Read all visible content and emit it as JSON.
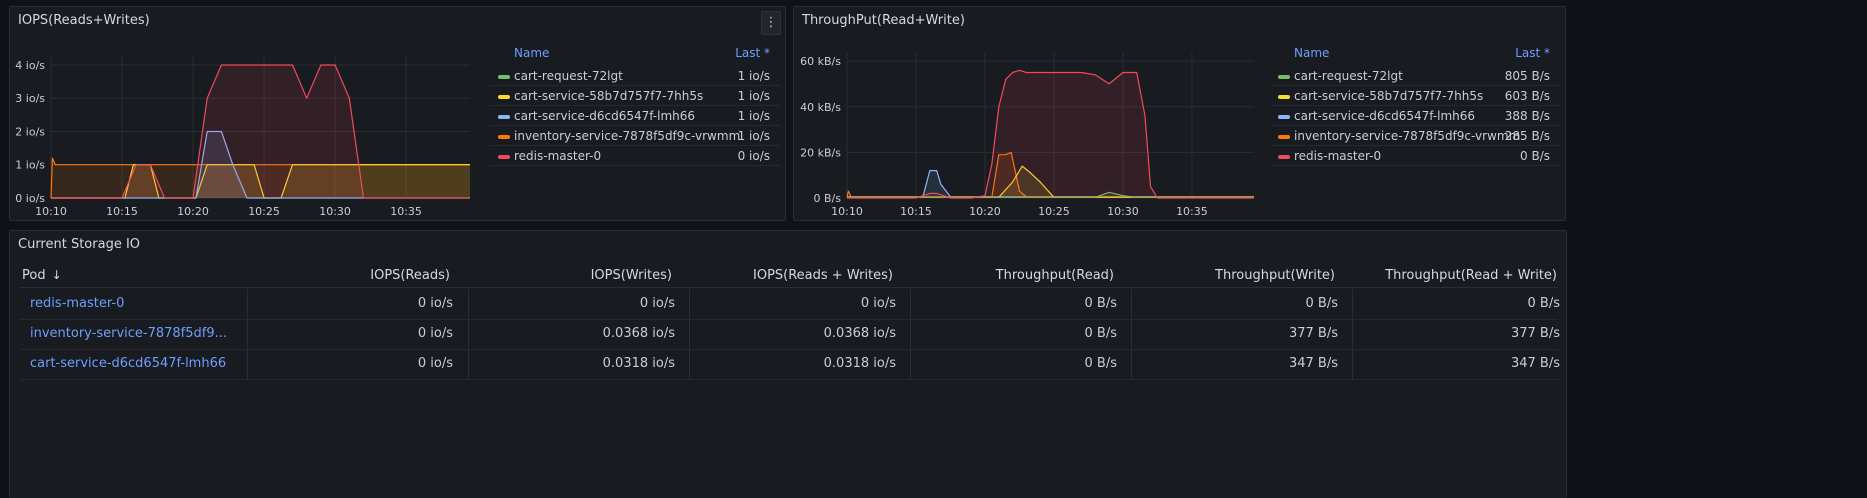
{
  "iops_panel": {
    "title": "IOPS(Reads+Writes)",
    "menu_icon": "more-vertical-icon",
    "legend": {
      "name_header": "Name",
      "last_header": "Last *",
      "items": [
        {
          "name": "cart-request-72lgt",
          "last": "1 io/s",
          "color": "#73bf69"
        },
        {
          "name": "cart-service-58b7d757f7-7hh5s",
          "last": "1 io/s",
          "color": "#fade2a"
        },
        {
          "name": "cart-service-d6cd6547f-lmh66",
          "last": "1 io/s",
          "color": "#8ab8ff"
        },
        {
          "name": "inventory-service-7878f5df9c-vrwmm",
          "last": "1 io/s",
          "color": "#ff780a"
        },
        {
          "name": "redis-master-0",
          "last": "0 io/s",
          "color": "#f2495c"
        }
      ]
    },
    "chart_data": {
      "type": "area",
      "ylim": [
        0,
        4.3
      ],
      "y_ticks": [
        "0 io/s",
        "1 io/s",
        "2 io/s",
        "3 io/s",
        "4 io/s"
      ],
      "y_tick_values": [
        0,
        1,
        2,
        3,
        4
      ],
      "x_ticks": [
        "10:10",
        "10:15",
        "10:20",
        "10:25",
        "10:30",
        "10:35"
      ],
      "x_tick_values": [
        0,
        5,
        10,
        15,
        20,
        25
      ],
      "xlim": [
        0,
        29.5
      ],
      "series": [
        {
          "name": "inventory-service-7878f5df9c-vrwmm",
          "color": "#ff780a",
          "x": [
            0,
            0.1,
            0.3,
            29.5
          ],
          "y": [
            0,
            1.2,
            1,
            1
          ]
        },
        {
          "name": "cart-service-58b7d757f7-7hh5s",
          "color": "#fade2a",
          "x": [
            0,
            5.2,
            5.8,
            6.4,
            7,
            7.6,
            10.2,
            11,
            12,
            13,
            14.3,
            15,
            16.2,
            17,
            29.5
          ],
          "y": [
            0,
            0,
            1,
            1,
            1,
            0,
            0,
            1,
            1,
            1,
            1,
            0,
            0,
            1,
            1
          ]
        },
        {
          "name": "cart-service-d6cd6547f-lmh66",
          "color": "#8ab8ff",
          "x": [
            0,
            10.2,
            11,
            12,
            12.8,
            13.8,
            29.5
          ],
          "y": [
            0,
            0,
            2,
            2,
            1,
            0,
            0
          ]
        },
        {
          "name": "redis-master-0",
          "color": "#f2495c",
          "x": [
            0,
            5,
            6,
            7,
            8,
            10,
            11,
            12,
            13,
            14,
            15,
            17,
            18,
            19,
            20,
            21,
            22,
            29.5
          ],
          "y": [
            0,
            0,
            1,
            1,
            0,
            0,
            3,
            4,
            4,
            4,
            4,
            4,
            3,
            4,
            4,
            3,
            0,
            0
          ]
        }
      ]
    }
  },
  "throughput_panel": {
    "title": "ThroughPut(Read+Write)",
    "legend": {
      "name_header": "Name",
      "last_header": "Last *",
      "items": [
        {
          "name": "cart-request-72lgt",
          "last": "805 B/s",
          "color": "#73bf69"
        },
        {
          "name": "cart-service-58b7d757f7-7hh5s",
          "last": "603 B/s",
          "color": "#fade2a"
        },
        {
          "name": "cart-service-d6cd6547f-lmh66",
          "last": "388 B/s",
          "color": "#8ab8ff"
        },
        {
          "name": "inventory-service-7878f5df9c-vrwmm",
          "last": "285 B/s",
          "color": "#ff780a"
        },
        {
          "name": "redis-master-0",
          "last": "0 B/s",
          "color": "#f2495c"
        }
      ]
    },
    "chart_data": {
      "type": "area",
      "ylim": [
        0,
        64
      ],
      "y_ticks": [
        "0 B/s",
        "20 kB/s",
        "40 kB/s",
        "60 kB/s"
      ],
      "y_tick_values": [
        0,
        20,
        40,
        60
      ],
      "x_ticks": [
        "10:10",
        "10:15",
        "10:20",
        "10:25",
        "10:30",
        "10:35"
      ],
      "x_tick_values": [
        0,
        5,
        10,
        15,
        20,
        25
      ],
      "xlim": [
        0,
        29.5
      ],
      "series": [
        {
          "name": "cart-service-d6cd6547f-lmh66",
          "color": "#8ab8ff",
          "x": [
            0,
            5.5,
            6,
            6.5,
            6.8,
            7.5,
            8,
            29.5
          ],
          "y": [
            0.5,
            0.5,
            12,
            12,
            6,
            0.5,
            0.5,
            0.5
          ]
        },
        {
          "name": "inventory-service-7878f5df9c-vrwmm",
          "color": "#ff780a",
          "x": [
            0,
            0.1,
            0.3,
            10.5,
            11,
            11.5,
            11.9,
            12.5,
            13,
            29.5
          ],
          "y": [
            0.5,
            3,
            0.5,
            0.5,
            19,
            19,
            20,
            3,
            0.5,
            0.5
          ]
        },
        {
          "name": "cart-service-58b7d757f7-7hh5s",
          "color": "#fade2a",
          "x": [
            0,
            11,
            12,
            12.7,
            13.3,
            14,
            14.6,
            15,
            29.5
          ],
          "y": [
            0.3,
            0.3,
            7,
            14,
            11,
            7,
            3,
            0.3,
            0.3
          ]
        },
        {
          "name": "cart-request-72lgt",
          "color": "#73bf69",
          "x": [
            0,
            18,
            19,
            20,
            21,
            29.5
          ],
          "y": [
            0.3,
            0.3,
            2.5,
            1,
            0.3,
            0.3
          ]
        },
        {
          "name": "redis-master-0",
          "color": "#f2495c",
          "x": [
            0,
            5,
            6,
            6.5,
            7,
            7.5,
            9,
            10,
            10.5,
            11,
            11.5,
            12,
            12.5,
            13,
            15,
            17,
            18,
            19,
            20,
            21,
            21.6,
            22,
            22.5,
            29.5
          ],
          "y": [
            0,
            0,
            2,
            2,
            1,
            0,
            0,
            1,
            15,
            40,
            52,
            55,
            56,
            55,
            55,
            55,
            54,
            50,
            55,
            55,
            36,
            5,
            0,
            0
          ]
        }
      ]
    }
  },
  "storage_panel": {
    "title": "Current Storage IO",
    "columns": [
      {
        "label": "Pod",
        "sort_icon": "arrow-down-icon"
      },
      {
        "label": "IOPS(Reads)"
      },
      {
        "label": "IOPS(Writes)"
      },
      {
        "label": "IOPS(Reads + Writes)"
      },
      {
        "label": "Throughput(Read)"
      },
      {
        "label": "Throughput(Write)"
      },
      {
        "label": "Throughput(Read + Write)"
      }
    ],
    "sort_arrow": "↓",
    "rows": [
      {
        "pod": "redis-master-0",
        "iops_reads": "0 io/s",
        "iops_writes": "0 io/s",
        "iops_rw": "0 io/s",
        "tp_read": "0 B/s",
        "tp_write": "0 B/s",
        "tp_rw": "0 B/s"
      },
      {
        "pod": "inventory-service-7878f5df9...",
        "iops_reads": "0 io/s",
        "iops_writes": "0.0368 io/s",
        "iops_rw": "0.0368 io/s",
        "tp_read": "0 B/s",
        "tp_write": "377 B/s",
        "tp_rw": "377 B/s"
      },
      {
        "pod": "cart-service-d6cd6547f-lmh66",
        "iops_reads": "0 io/s",
        "iops_writes": "0.0318 io/s",
        "iops_rw": "0.0318 io/s",
        "tp_read": "0 B/s",
        "tp_write": "347 B/s",
        "tp_rw": "347 B/s"
      }
    ]
  }
}
